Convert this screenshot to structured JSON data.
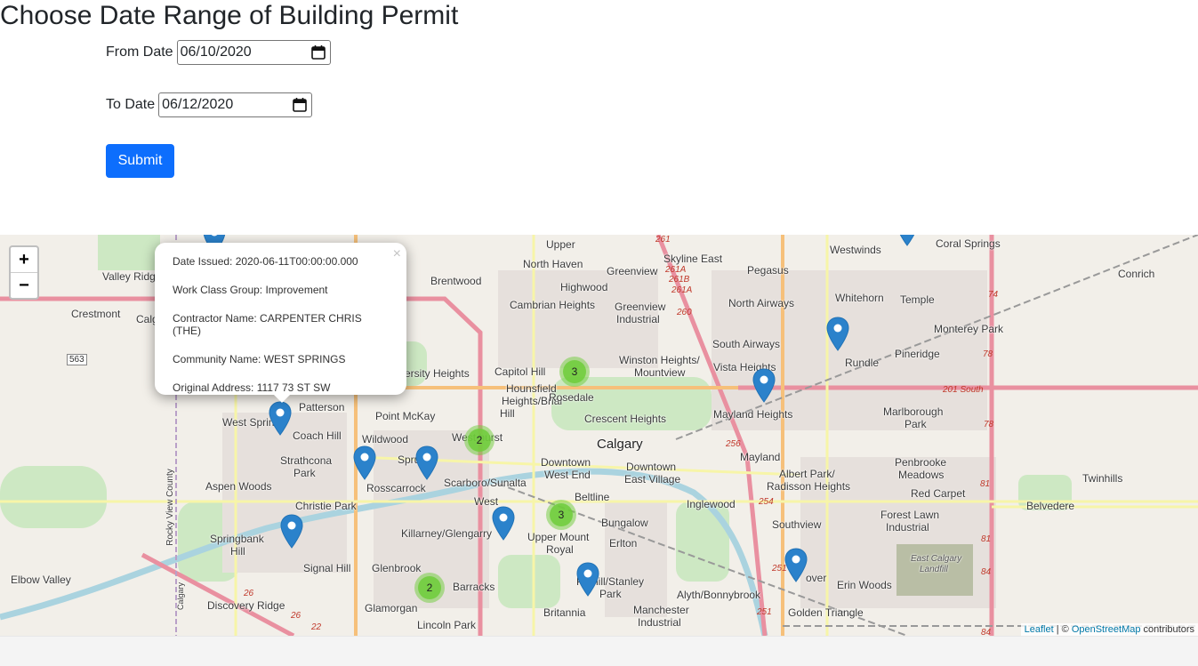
{
  "page": {
    "title": "Choose Date Range of Building Permit",
    "from_label": "From Date",
    "from_value": "06/10/2020",
    "to_label": "To Date",
    "to_value": "06/12/2020",
    "submit_label": "Submit"
  },
  "map": {
    "zoom_in": "+",
    "zoom_out": "−",
    "popup": {
      "close": "×",
      "date_issued": "Date Issued: 2020-06-11T00:00:00.000",
      "work_class": "Work Class Group: Improvement",
      "contractor": "Contractor Name: CARPENTER CHRIS (THE)",
      "community": "Community Name: WEST SPRINGS",
      "address": "Original Address: 1117 73 ST SW"
    },
    "clusters": [
      "3",
      "2",
      "3",
      "2"
    ],
    "attribution": {
      "leaflet": "Leaflet",
      "sep": " | © ",
      "osm": "OpenStreetMap",
      "suffix": " contributors"
    },
    "places": {
      "upper": "Upper",
      "north_haven": "North Haven",
      "skyline_east": "Skyline East",
      "westwinds": "Westwinds",
      "coral_springs": "Coral Springs",
      "conrich": "Conrich",
      "valley_ridge": "Valley Ridge",
      "brentwood": "Brentwood",
      "greenview": "Greenview",
      "pegasus": "Pegasus",
      "whitehorn": "Whitehorn",
      "temple": "Temple",
      "highwood": "Highwood",
      "crestmont": "Crestmont",
      "calg": "Calg",
      "cambrian_heights": "Cambrian Heights",
      "greenview_industrial_1": "Greenview",
      "greenview_industrial_2": "Industrial",
      "north_airways": "North Airways",
      "monterey_park": "Monterey Park",
      "south_airways": "South Airways",
      "rundle": "Rundle",
      "pineridge": "Pineridge",
      "university_heights": "ersity Heights",
      "capitol_hill": "Capitol Hill",
      "winston_heights": "Winston Heights/",
      "mountview": "Mountview",
      "vista_heights": "Vista Heights",
      "hounsfield_1": "Hounsfield",
      "hounsfield_2": "Heights/Briar",
      "hounsfield_3": "Hill",
      "rosedale": "Rosedale",
      "patterson": "Patterson",
      "crescent_heights": "Crescent Heights",
      "mayland_heights": "Mayland Heights",
      "marlborough_park_1": "Marlborough",
      "marlborough_park_2": "Park",
      "point_mckay": "Point McKay",
      "west_springs": "West Spring",
      "coach_hill": "Coach Hill",
      "wildwood": "Wildwood",
      "westhurst": "West    hurst",
      "calgary": "Calgary",
      "strathcona_park_1": "Strathcona",
      "strathcona_park_2": "Park",
      "spruce_cliff": "Spru     iff",
      "downtown_west_1": "Downtown",
      "downtown_west_2": "West End",
      "downtown_east_1": "Downtown",
      "downtown_east_2": "East Village",
      "mayland": "Mayland",
      "albert_park_1": "Albert Park/",
      "albert_park_2": "Radisson Heights",
      "penbrooke_1": "Penbrooke",
      "penbrooke_2": "Meadows",
      "twinhills": "Twinhills",
      "aspen_woods": "Aspen Woods",
      "rosscarrock": "Rosscarrock",
      "scarboro": "Scarboro/Sunalta",
      "scarboro_west": "West",
      "beltline": "Beltline",
      "red_carpet": "Red Carpet",
      "christie_park": "Christie Park",
      "inglewood": "Inglewood",
      "belvedere": "Belvedere",
      "rocky_view_county": "Rocky View County",
      "bungalow": "Bungalow",
      "forest_lawn_1": "Forest Lawn",
      "forest_lawn_2": "Industrial",
      "springbank_hill_1": "Springbank",
      "springbank_hill_2": "Hill",
      "killarney": "Killarney/Glengarry",
      "upper_mount_royal_1": "Upper Mount",
      "upper_mount_royal_2": "Royal",
      "erlton": "Erlton",
      "southview": "Southview",
      "east_calgary_landfill_1": "East Calgary",
      "east_calgary_landfill_2": "Landfill",
      "signal_hill": "Signal Hill",
      "glenbrook": "Glenbrook",
      "elbow_valley": "Elbow Valley",
      "parkhill_1": "Pa    hill/Stanley",
      "parkhill_2": "Park",
      "dover": "over",
      "erin_woods": "Erin Woods",
      "barracks": "Barracks",
      "alyth": "Alyth/Bonnybrook",
      "discovery_ridge": "Discovery Ridge",
      "glamorgan": "Glamorgan",
      "britannia": "Britannia",
      "manchester_1": "Manchester",
      "manchester_2": "Industrial",
      "golden_triangle": "Golden Triangle",
      "lincoln_park": "Lincoln Park",
      "calgary_vertical": "Calgary"
    },
    "routes": {
      "r261": "261",
      "r261a": "261A",
      "r261b": "261B",
      "r261a2": "261A",
      "r260": "260",
      "r74": "74",
      "r78": "78",
      "r201": "201 South",
      "r78b": "78",
      "r256": "256",
      "r81": "81",
      "r254": "254",
      "r81b": "81",
      "r251": "251",
      "r84": "84",
      "r251b": "251",
      "r26": "26",
      "r26b": "26",
      "r22": "22",
      "r84b": "84",
      "r563": "563"
    }
  }
}
